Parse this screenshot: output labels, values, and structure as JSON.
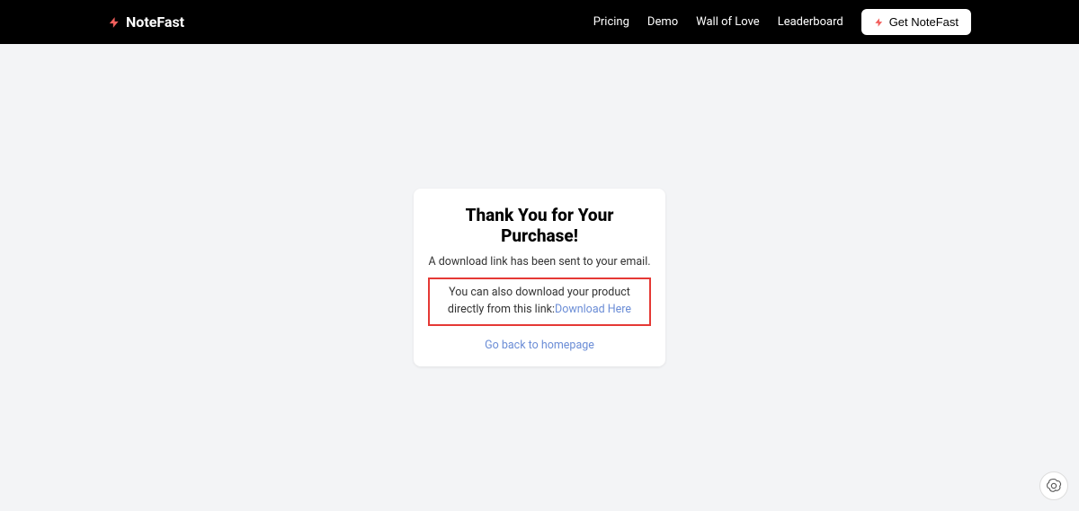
{
  "header": {
    "brand": "NoteFast",
    "nav": {
      "pricing": "Pricing",
      "demo": "Demo",
      "wall_of_love": "Wall of Love",
      "leaderboard": "Leaderboard"
    },
    "cta": "Get NoteFast"
  },
  "card": {
    "title": "Thank You for Your Purchase!",
    "sent": "A download link has been sent to your email.",
    "download_prefix": "You can also download your product directly from this link:",
    "download_link": "Download Here",
    "homepage": "Go back to homepage"
  }
}
